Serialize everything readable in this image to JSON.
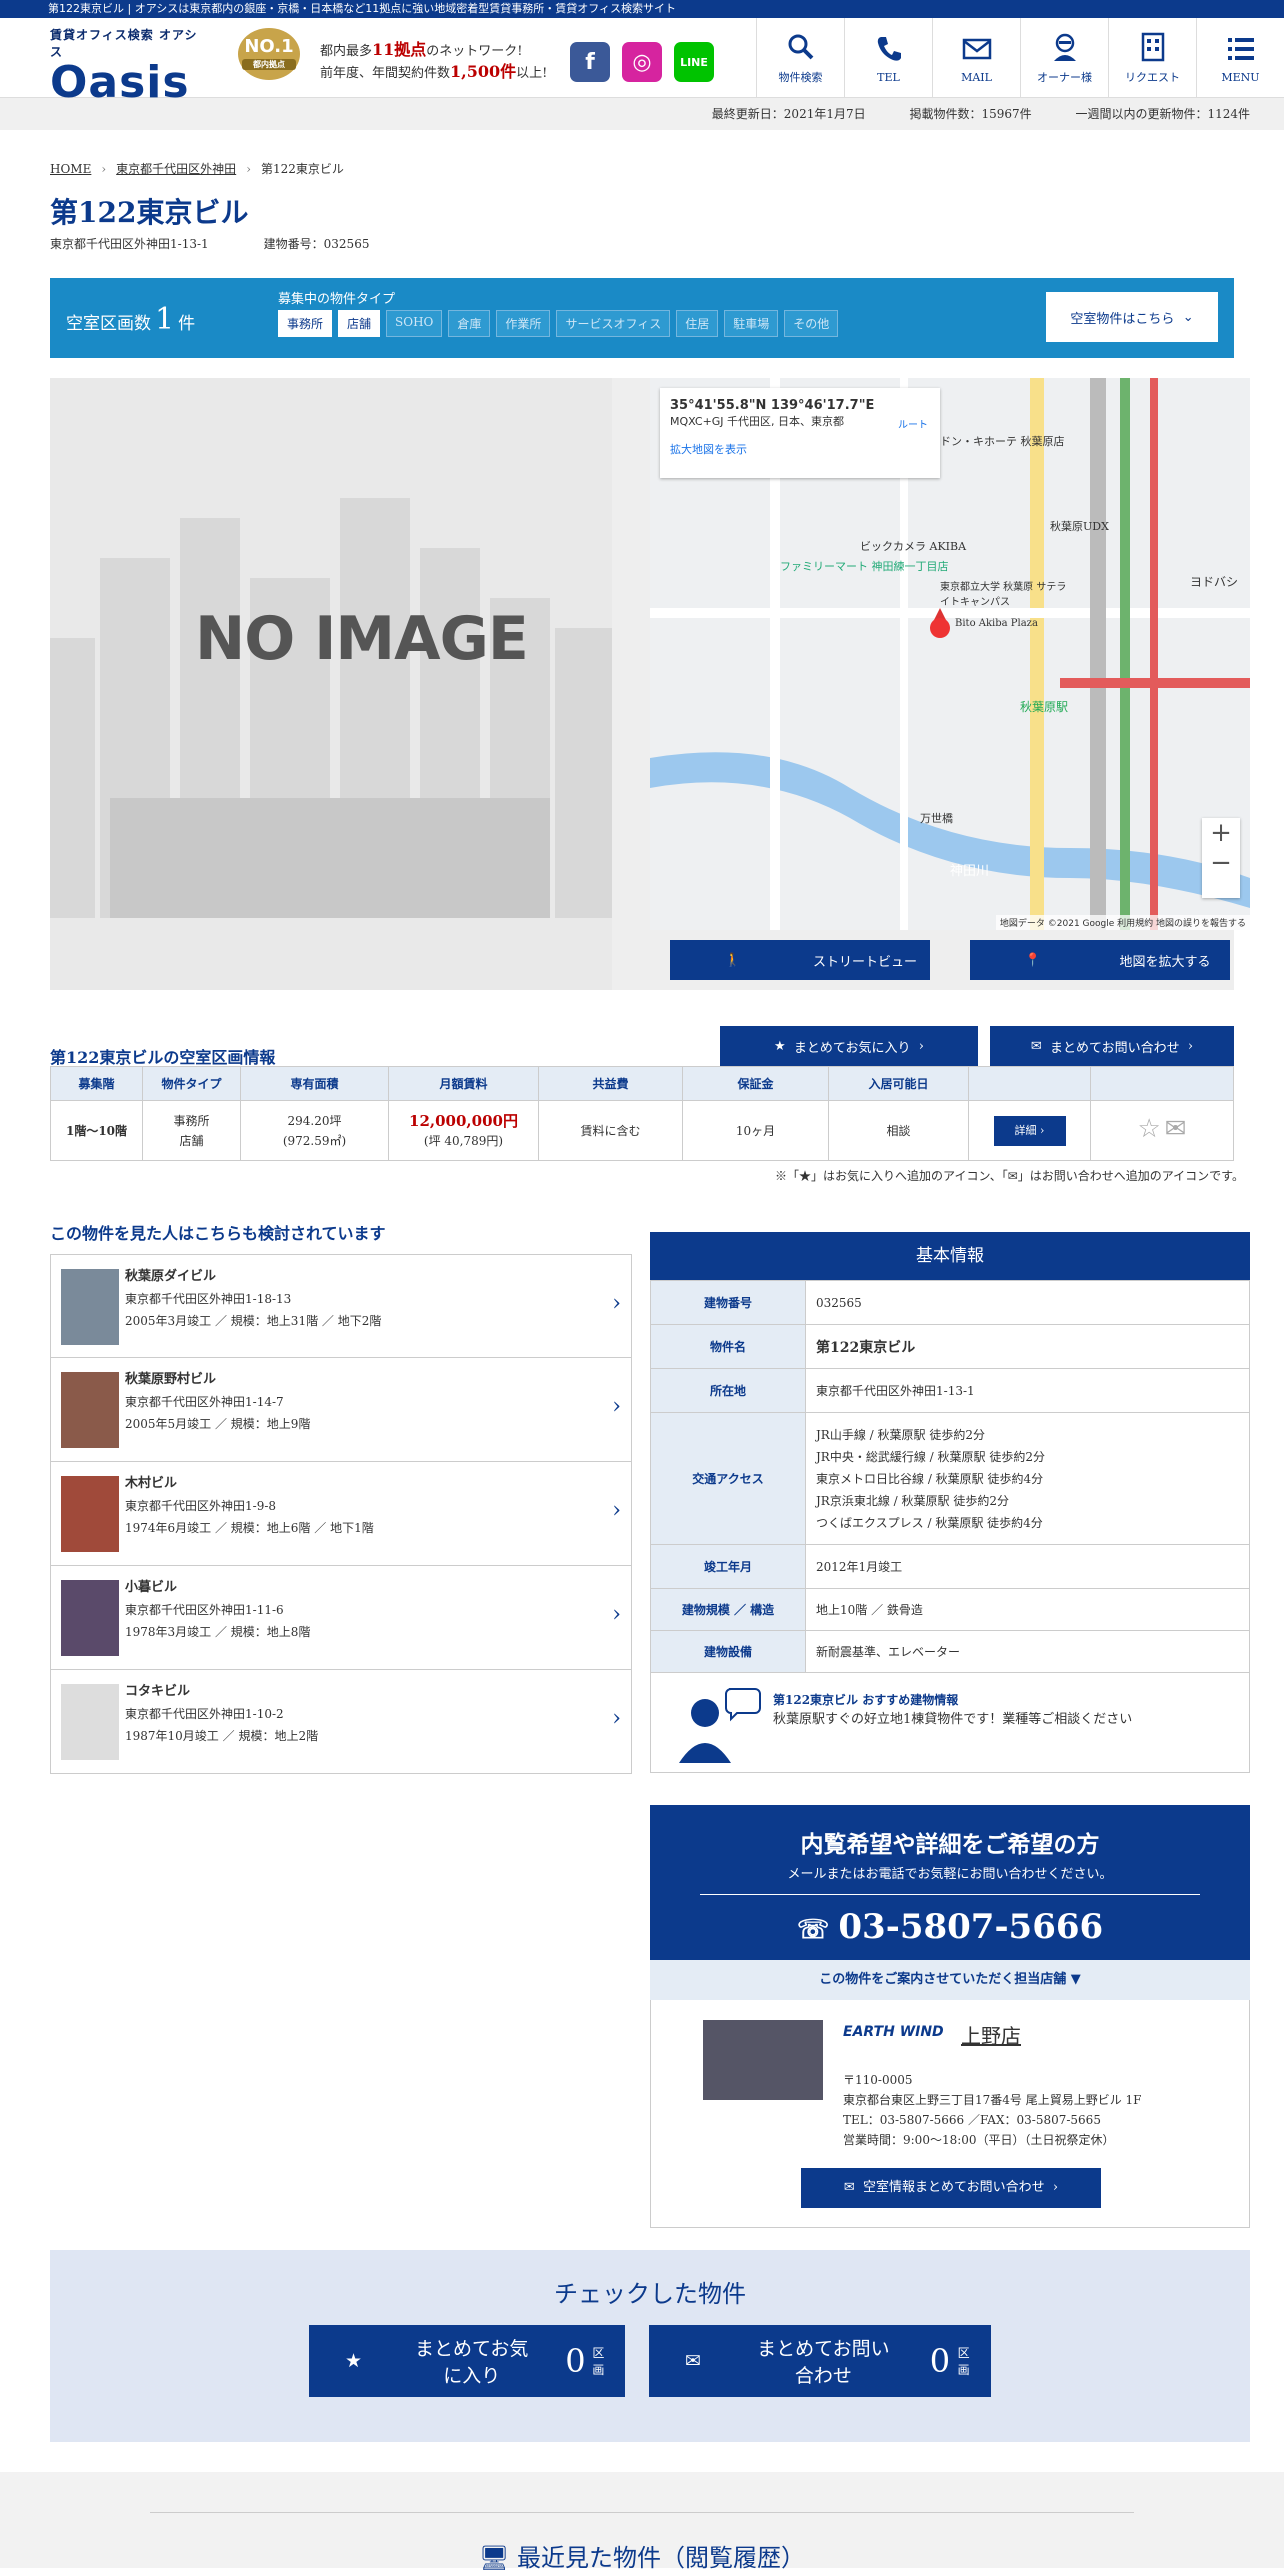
{
  "topline": "第122東京ビル | オアシスは東京都内の銀座・京橋・日本橋など11拠点に強い地域密着型賃貸事務所・賃貸オフィス検索サイト",
  "logo": {
    "sub": "賃貸オフィス検索 オアシス",
    "main": "Oasis"
  },
  "badge": {
    "no": "NO.1",
    "sub": "都内拠点"
  },
  "tagline": {
    "l1a": "都内最多",
    "l1b": "11拠点",
    "l1c": "のネットワーク!",
    "l2a": "前年度、年間契約件数",
    "l2b": "1,500件",
    "l2c": "以上!"
  },
  "social": {
    "fb": "f",
    "ig": "◎",
    "line": "LINE"
  },
  "nav": [
    {
      "label": "物件検索",
      "icon": "search-icon"
    },
    {
      "label": "TEL",
      "icon": "phone-icon"
    },
    {
      "label": "MAIL",
      "icon": "mail-icon"
    },
    {
      "label": "オーナー様",
      "icon": "owner-icon"
    },
    {
      "label": "リクエスト",
      "icon": "building-icon"
    },
    {
      "label": "MENU",
      "icon": "menu-icon"
    }
  ],
  "status": {
    "updated": "最終更新日：2021年1月7日",
    "count": "掲載物件数：15967件",
    "weekly": "一週間以内の更新物件：1124件"
  },
  "crumb": {
    "home": "HOME",
    "area": "東京都千代田区外神田",
    "current": "第122東京ビル"
  },
  "building": {
    "name": "第122東京ビル",
    "address": "東京都千代田区外神田1-13-1",
    "number": "建物番号：032565"
  },
  "vacancy": {
    "label_a": "空室区画数",
    "count": "1",
    "label_b": "件",
    "types_title": "募集中の物件タイプ",
    "types": [
      {
        "name": "事務所",
        "on": true
      },
      {
        "name": "店舗",
        "on": true
      },
      {
        "name": "SOHO",
        "on": false
      },
      {
        "name": "倉庫",
        "on": false
      },
      {
        "name": "作業所",
        "on": false
      },
      {
        "name": "サービスオフィス",
        "on": false
      },
      {
        "name": "住居",
        "on": false
      },
      {
        "name": "駐車場",
        "on": false
      },
      {
        "name": "その他",
        "on": false
      }
    ],
    "button": "空室物件はこちら"
  },
  "gallery": {
    "noimage": "NO IMAGE"
  },
  "map": {
    "coords": "35°41'55.8\"N 139°46'17.7\"E",
    "place": "MQXC+GJ 千代田区, 日本、東京都",
    "route": "ルート",
    "enlarge": "拡大地図を表示",
    "footer": "地図データ ©2021 Google  利用規約  地図の誤りを報告する",
    "labels": [
      "ドン・キホーテ 秋葉原店",
      "ビックカメラ AKIBA",
      "東京都立大学 秋葉原 サテライトキャンパス",
      "Bito Akiba Plaza",
      "ファミリーマート 神田練一丁目店",
      "秋葉原駅",
      "神田川",
      "万世橋",
      "秋葉原UDX",
      "ヨドバシ"
    ]
  },
  "gallery_buttons": {
    "street": "ストリートビュー",
    "expand": "地図を拡大する"
  },
  "vacinfo": {
    "title": "第122東京ビルの空室区画情報",
    "fav": "まとめてお気に入り",
    "inq": "まとめてお問い合わせ",
    "headers": [
      "募集階",
      "物件タイプ",
      "専有面積",
      "月額賃料",
      "共益費",
      "保証金",
      "入居可能日",
      ""
    ],
    "row": {
      "floor": "1階～10階",
      "type1": "事務所",
      "type2": "店舗",
      "area1": "294.20坪",
      "area2": "(972.59㎡)",
      "rent1": "12,000,000円",
      "rent2": "(坪 40,789円)",
      "common": "賃料に含む",
      "deposit": "10ヶ月",
      "date": "相談",
      "detail": "詳細"
    },
    "note": "※「★」はお気に入りへ追加のアイコン、「✉」はお問い合わせへ追加のアイコンです。"
  },
  "related": {
    "title": "この物件を見た人はこちらも検討されています",
    "items": [
      {
        "name": "秋葉原ダイビル",
        "addr": "東京都千代田区外神田1-18-13",
        "info": "2005年3月竣工 ／ 規模：地上31階 ／ 地下2階",
        "color": "#7a8a9a"
      },
      {
        "name": "秋葉原野村ビル",
        "addr": "東京都千代田区外神田1-14-7",
        "info": "2005年5月竣工 ／ 規模：地上9階",
        "color": "#8a5a4a"
      },
      {
        "name": "木村ビル",
        "addr": "東京都千代田区外神田1-9-8",
        "info": "1974年6月竣工 ／ 規模：地上6階 ／ 地下1階",
        "color": "#a04a3a"
      },
      {
        "name": "小暮ビル",
        "addr": "東京都千代田区外神田1-11-6",
        "info": "1978年3月竣工 ／ 規模：地上8階",
        "color": "#5a4a6a"
      },
      {
        "name": "コタキビル",
        "addr": "東京都千代田区外神田1-10-2",
        "info": "1987年10月竣工 ／ 規模：地上2階",
        "color": "#dddddd"
      }
    ]
  },
  "basic": {
    "title": "基本情報",
    "rows": [
      {
        "k": "建物番号",
        "v": "032565"
      },
      {
        "k": "物件名",
        "v": "第122東京ビル"
      },
      {
        "k": "所在地",
        "v": "東京都千代田区外神田1-13-1"
      },
      {
        "k": "交通アクセス",
        "lines": [
          "JR山手線 / 秋葉原駅 徒歩約2分",
          "JR中央・総武緩行線 / 秋葉原駅 徒歩約2分",
          "東京メトロ日比谷線 / 秋葉原駅 徒歩約4分",
          "JR京浜東北線 / 秋葉原駅 徒歩約2分",
          "つくばエクスプレス / 秋葉原駅 徒歩約4分"
        ]
      },
      {
        "k": "竣工年月",
        "v": "2012年1月竣工"
      },
      {
        "k": "建物規模 ／ 構造",
        "v": "地上10階 ／ 鉄骨造"
      },
      {
        "k": "建物設備",
        "v": "新耐震基準、エレベーター"
      }
    ],
    "recom_title": "第122東京ビル おすすめ建物情報",
    "recom_text": "秋葉原駅すぐの好立地1棟貸物件です！業種等ご相談ください"
  },
  "cta": {
    "t1": "内覧希望や詳細をご希望の方",
    "t2": "メールまたはお電話でお気軽にお問い合わせください。",
    "tel": "03-5807-5666",
    "store_head": "この物件をご案内させていただく担当店舗 ▼"
  },
  "store": {
    "brand": "EARTH WIND",
    "name": "上野店",
    "zip": "〒110-0005",
    "addr": "東京都台東区上野三丁目17番4号 尾上貿易上野ビル 1F",
    "tel": "TEL：03-5807-5666 ／FAX：03-5807-5665",
    "hours": "営業時間：9:00～18:00（平日）（土日祝祭定休）",
    "button": "空室情報まとめてお問い合わせ"
  },
  "checked": {
    "title": "チェックした物件",
    "fav": "まとめてお気に入り",
    "fav_count": "0",
    "inq": "まとめてお問い合わせ",
    "inq_count": "0",
    "unit": "区画"
  },
  "recent": {
    "title": "最近見た物件（閲覧履歴）"
  }
}
